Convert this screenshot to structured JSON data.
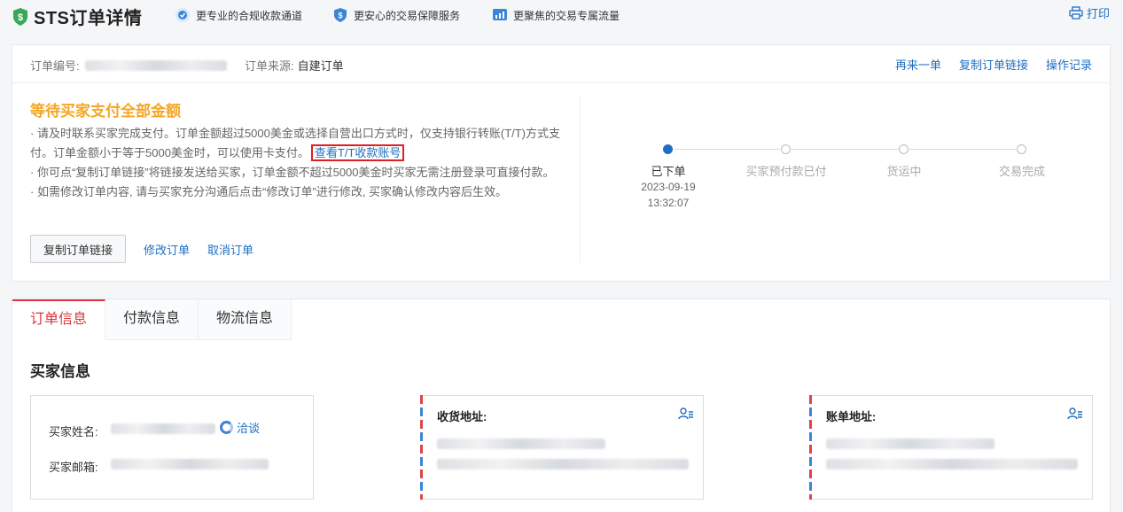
{
  "header": {
    "title": "STS订单详情",
    "promos": [
      {
        "icon": "compliance-badge-icon",
        "text": "更专业的合规收款通道"
      },
      {
        "icon": "shield-dollar-icon",
        "text": "更安心的交易保障服务"
      },
      {
        "icon": "traffic-chart-icon",
        "text": "更聚焦的交易专属流量"
      }
    ],
    "print_label": "打印"
  },
  "order": {
    "id_label": "订单编号:",
    "source_label": "订单来源:",
    "source_value": "自建订单",
    "links": [
      "再来一单",
      "复制订单链接",
      "操作记录"
    ],
    "status_title": "等待买家支付全部金额",
    "notes": [
      "· 请及时联系买家完成支付。订单金额超过5000美金或选择自营出口方式时，仅支持银行转账(T/T)方式支付。订单金额小于等于5000美金时，可以使用卡支付。",
      "· 你可点“复制订单链接”将链接发送给买家，订单金额不超过5000美金时买家无需注册登录可直接付款。",
      "· 如需修改订单内容, 请与买家充分沟通后点击“修改订单”进行修改, 买家确认修改内容后生效。"
    ],
    "tt_link": "查看T/T收款账号",
    "copy_button": "复制订单链接",
    "modify_link": "修改订单",
    "cancel_link": "取消订单",
    "steps": [
      "已下单",
      "买家预付款已付",
      "货运中",
      "交易完成"
    ],
    "current_step_date": "2023-09-19",
    "current_step_time": "13:32:07"
  },
  "tabs": [
    "订单信息",
    "付款信息",
    "物流信息"
  ],
  "buyer": {
    "section_title": "买家信息",
    "name_label": "买家姓名:",
    "chat_label": "洽谈",
    "email_label": "买家邮箱:",
    "shipping_label": "收货地址:",
    "billing_label": "账单地址:"
  },
  "colors": {
    "accent": "#1e6fc3",
    "warning": "#f5a623",
    "active_tab": "#d9363e",
    "highlight_border": "#e02020"
  }
}
